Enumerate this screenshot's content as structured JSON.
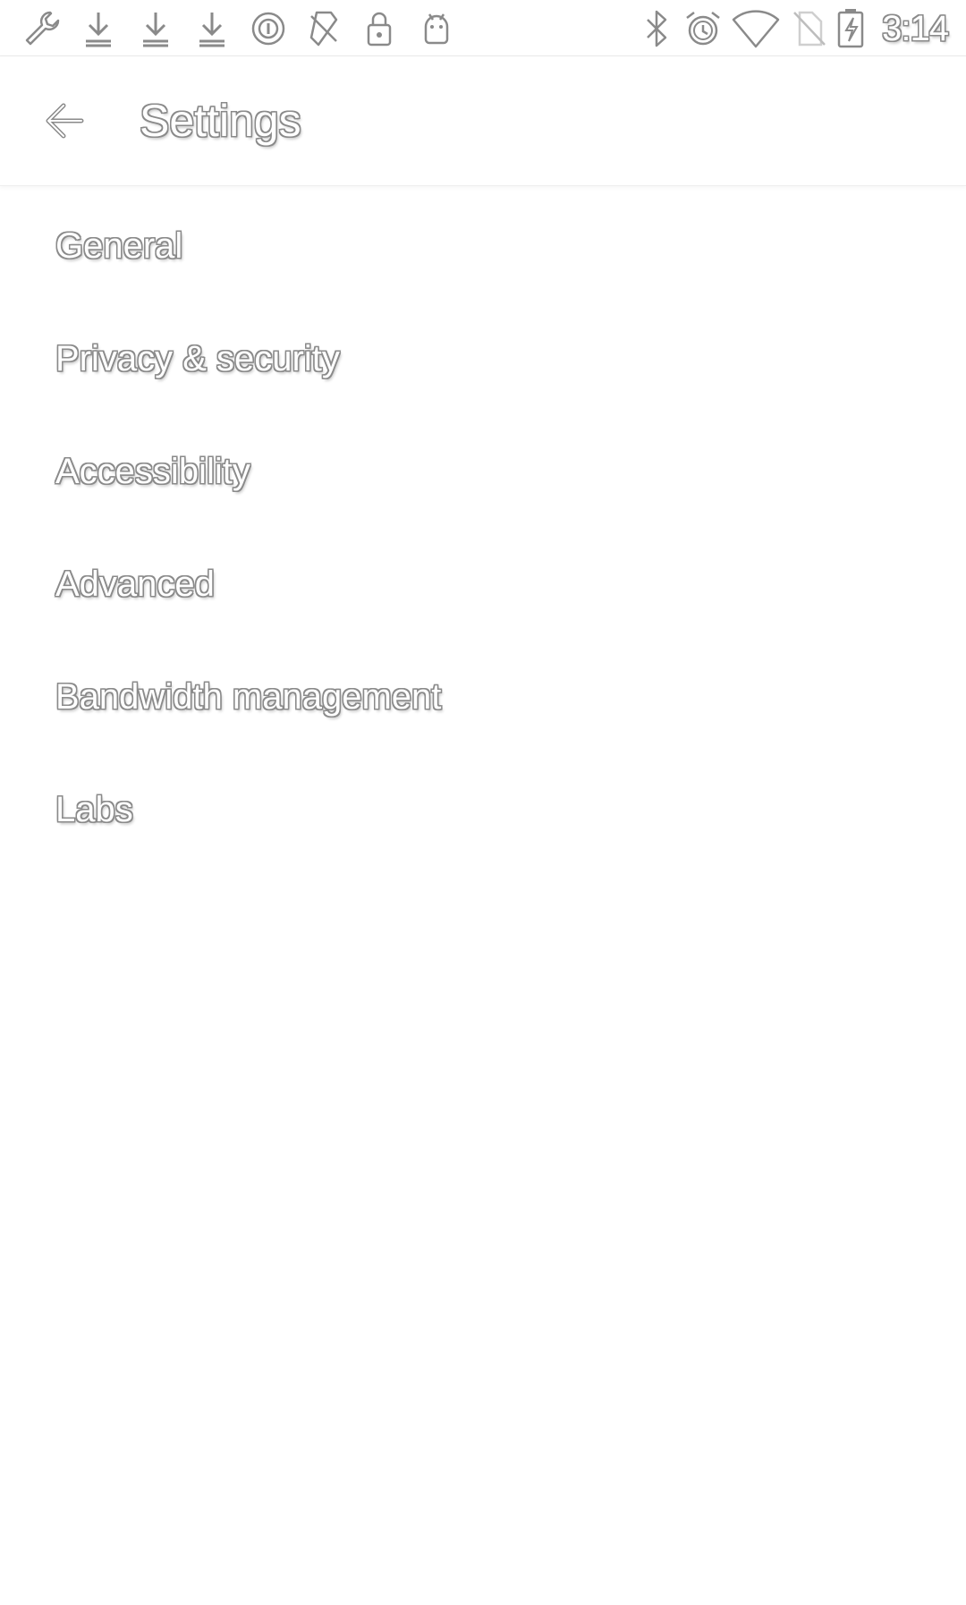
{
  "status_bar": {
    "left_icons": [
      "wrench-icon",
      "download-icon",
      "download-icon",
      "download-icon",
      "data-saver-icon",
      "no-sim-app-icon",
      "lock-icon",
      "android-icon"
    ],
    "right_icons": [
      "bluetooth-icon",
      "alarm-icon",
      "wifi-icon",
      "no-sim-icon",
      "battery-charging-icon"
    ],
    "time": "3:14"
  },
  "app_bar": {
    "title": "Settings"
  },
  "settings": {
    "items": [
      {
        "label": "General"
      },
      {
        "label": "Privacy & security"
      },
      {
        "label": "Accessibility"
      },
      {
        "label": "Advanced"
      },
      {
        "label": "Bandwidth management"
      },
      {
        "label": "Labs"
      }
    ]
  },
  "colors": {
    "background": "#ffffff",
    "outline": "#8a8a8a"
  }
}
